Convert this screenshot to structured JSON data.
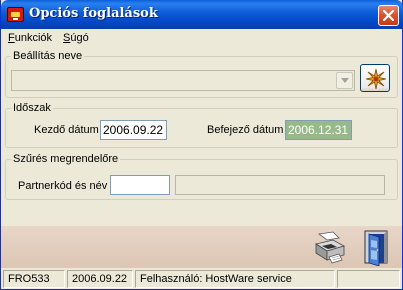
{
  "window": {
    "title": "Opciós foglalások",
    "accent": "#0a5fd8"
  },
  "menu": {
    "items": [
      {
        "first": "F",
        "rest": "unkciók"
      },
      {
        "first": "S",
        "rest": "úgó"
      }
    ]
  },
  "settings_group": {
    "legend": "Beállítás neve",
    "combo_value": ""
  },
  "period_group": {
    "legend": "Időszak",
    "start_label": "Kezdő dátum",
    "start_value": "2006.09.22",
    "end_label": "Befejező dátum",
    "end_value": "2006.12.31"
  },
  "filter_group": {
    "legend": "Szűrés megrendelőre",
    "partner_label": "Partnerkód és név",
    "partner_code": "",
    "partner_name": ""
  },
  "toolbar": {
    "print_icon": "printer-icon",
    "exit_icon": "exit-door-icon",
    "settings_icon": "sparkle-icon"
  },
  "status": {
    "code": "FRO533",
    "date": "2006.09.22",
    "user": "Felhasználó: HostWare service",
    "extra": ""
  }
}
